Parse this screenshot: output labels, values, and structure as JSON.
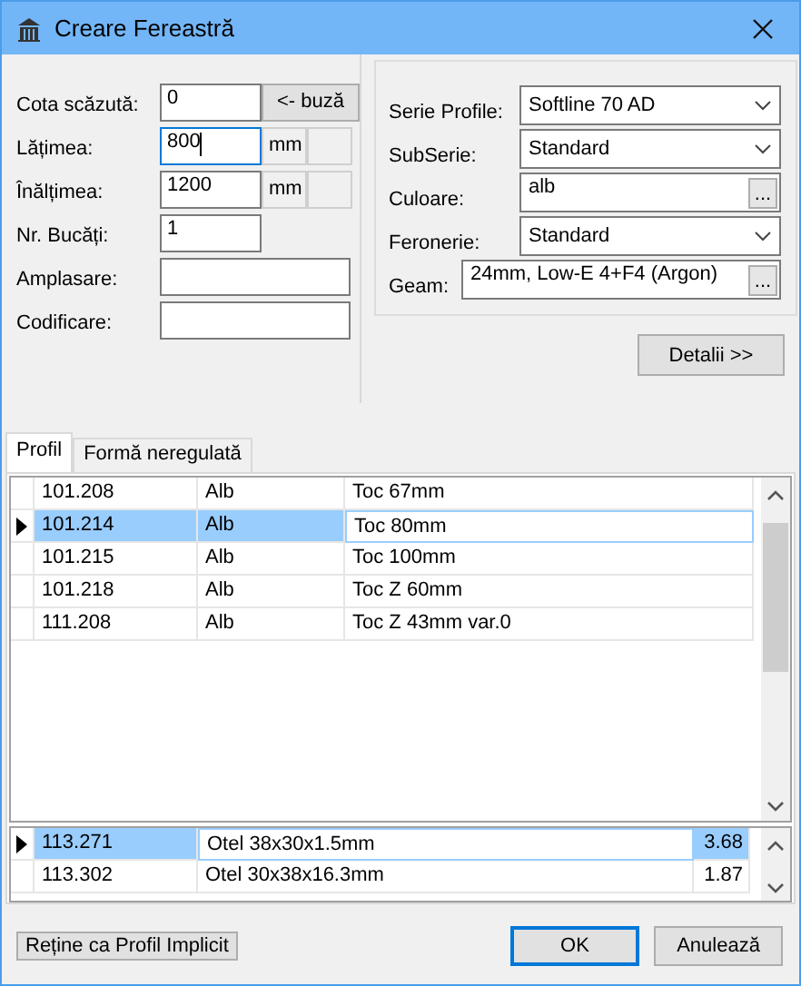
{
  "window": {
    "title": "Creare Fereastră"
  },
  "left_form": {
    "fields": [
      {
        "label": "Cota scăzută:",
        "kind": "input_button",
        "value": "0",
        "button": "<- buză",
        "focused": false
      },
      {
        "label": "Lățimea:",
        "kind": "input_unit",
        "value": "800",
        "unit": "mm",
        "focused": true
      },
      {
        "label": "Înălțimea:",
        "kind": "input_unit",
        "value": "1200",
        "unit": "mm",
        "focused": false
      },
      {
        "label": "Nr. Bucăți:",
        "kind": "input",
        "value": "1",
        "focused": false
      },
      {
        "label": "Amplasare:",
        "kind": "wide_input",
        "focused": false
      },
      {
        "label": "Codificare:",
        "kind": "wide_input",
        "focused": false
      }
    ]
  },
  "right_form": {
    "fields": [
      {
        "label": "Serie Profile:",
        "kind": "combo",
        "value": "Softline 70 AD"
      },
      {
        "label": "SubSerie:",
        "kind": "combo",
        "value": "Standard"
      },
      {
        "label": "Culoare:",
        "kind": "picker",
        "value": "alb",
        "button": "..."
      },
      {
        "label": "Feronerie:",
        "kind": "combo",
        "value": "Standard"
      },
      {
        "label": "Geam:",
        "kind": "wide_picker",
        "value": "24mm, Low-E 4+F4 (Argon)",
        "button": "..."
      }
    ]
  },
  "details_button": "Detalii >>",
  "tabs": [
    {
      "label": "Profil",
      "selected": true
    },
    {
      "label": "Formă neregulată",
      "selected": false
    }
  ],
  "profile_table": {
    "rows": [
      {
        "cells": [
          "101.208",
          "Alb",
          "Toc 67mm"
        ],
        "selected": false
      },
      {
        "cells": [
          "101.214",
          "Alb",
          "Toc 80mm"
        ],
        "selected": true
      },
      {
        "cells": [
          "101.215",
          "Alb",
          "Toc 100mm"
        ],
        "selected": false
      },
      {
        "cells": [
          "101.218",
          "Alb",
          "Toc Z 60mm"
        ],
        "selected": false
      },
      {
        "cells": [
          "111.208",
          "Alb",
          "Toc Z 43mm var.0"
        ],
        "selected": false
      }
    ]
  },
  "reinforcement_table": {
    "rows": [
      {
        "cells": [
          "113.271",
          "Otel 38x30x1.5mm",
          "3.68"
        ],
        "selected": true
      },
      {
        "cells": [
          "113.302",
          "Otel 30x38x16.3mm",
          "1.87"
        ],
        "selected": false
      }
    ]
  },
  "buttons": [
    {
      "label": "Reține ca Profil Implicit",
      "kind": "flat",
      "default": false
    },
    {
      "label": "OK",
      "kind": "dialog",
      "default": true
    },
    {
      "label": "Anulează",
      "kind": "dialog",
      "default": false
    }
  ]
}
